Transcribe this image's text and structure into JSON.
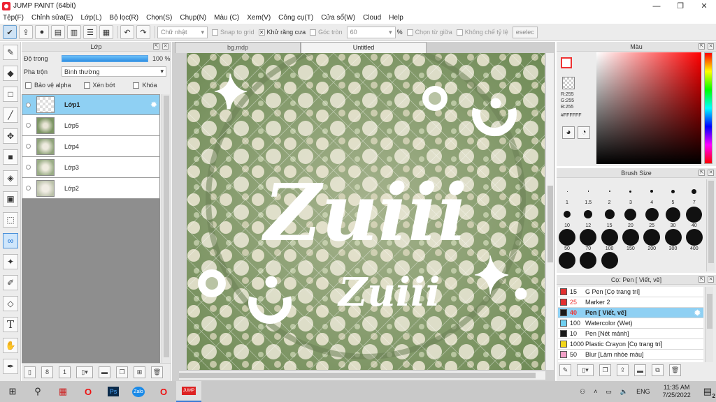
{
  "window": {
    "title": "JUMP PAINT (64bit)",
    "minimize": "—",
    "maximize": "❐",
    "close": "✕"
  },
  "menu": [
    "Tệp(F)",
    "Chỉnh sửa(E)",
    "Lớp(L)",
    "Bộ lọc(R)",
    "Chọn(S)",
    "Chụp(N)",
    "Màu (C)",
    "Xem(V)",
    "Công cụ(T)",
    "Cửa sổ(W)",
    "Cloud",
    "Help"
  ],
  "toolbar": {
    "shape": "Chữ nhật",
    "snap_grid": "Snap to grid",
    "antialias": "Khử răng cưa",
    "round_corner": "Góc tròn",
    "corner_value": "60",
    "percent": "%",
    "select_center": "Chọn từ giữa",
    "fixed_ratio": "Không chế tỷ lệ",
    "deselect": "eselec"
  },
  "layer_panel": {
    "title": "Lớp",
    "opacity_label": "Độ trong",
    "opacity_value": "100 %",
    "opacity_fraction": 1.0,
    "blend_label": "Pha trộn",
    "blend_value": "Bình thường",
    "protect_alpha": "Bảo vệ alpha",
    "clip": "Xén bớt",
    "lock": "Khóa",
    "layers": [
      {
        "name": "Lớp1",
        "selected": true
      },
      {
        "name": "Lớp5",
        "selected": false
      },
      {
        "name": "Lớp4",
        "selected": false
      },
      {
        "name": "Lớp3",
        "selected": false
      },
      {
        "name": "Lớp2",
        "selected": false
      }
    ]
  },
  "canvas": {
    "tabs": [
      "bg.mdp",
      "Untitled"
    ],
    "active_tab": "Untitled",
    "big_text": "Zuiii",
    "small_text": "Zuiii"
  },
  "color_panel": {
    "title": "Màu",
    "r": "R:255",
    "g": "G:255",
    "b": "B:255",
    "hex": "#FFFFFF",
    "accent_color": "#ff0000"
  },
  "brush_panel": {
    "title": "Brush Size",
    "sizes": [
      "1",
      "1.5",
      "2",
      "3",
      "4",
      "5",
      "7",
      "10",
      "12",
      "15",
      "20",
      "25",
      "30",
      "40",
      "50",
      "70",
      "100",
      "150",
      "200",
      "300",
      "400",
      "",
      "",
      ""
    ]
  },
  "pen_panel": {
    "title": "Cọ: Pen [ Viết, vẽ]",
    "pens": [
      {
        "size": "15",
        "name": "G Pen [Cọ trang trí]",
        "color": "#e23030"
      },
      {
        "size": "25",
        "name": "Marker 2",
        "color": "#e23030"
      },
      {
        "size": "40",
        "name": "Pen [ Viết, vẽ]",
        "color": "#1a1a1a"
      },
      {
        "size": "100",
        "name": "Watercolor (Wet)",
        "color": "#6ecff0"
      },
      {
        "size": "10",
        "name": "Pen [Nét mảnh]",
        "color": "#1a1a1a"
      },
      {
        "size": "1000",
        "name": "Plastic Crayon [Cọ trang trí]",
        "color": "#f2d61a"
      },
      {
        "size": "50",
        "name": "Blur [Làm nhòe màu]",
        "color": "#f2a0c8"
      }
    ]
  },
  "taskbar": {
    "time": "11:35 AM",
    "date": "7/25/2022",
    "lang": "ENG",
    "notification_count": "2"
  }
}
